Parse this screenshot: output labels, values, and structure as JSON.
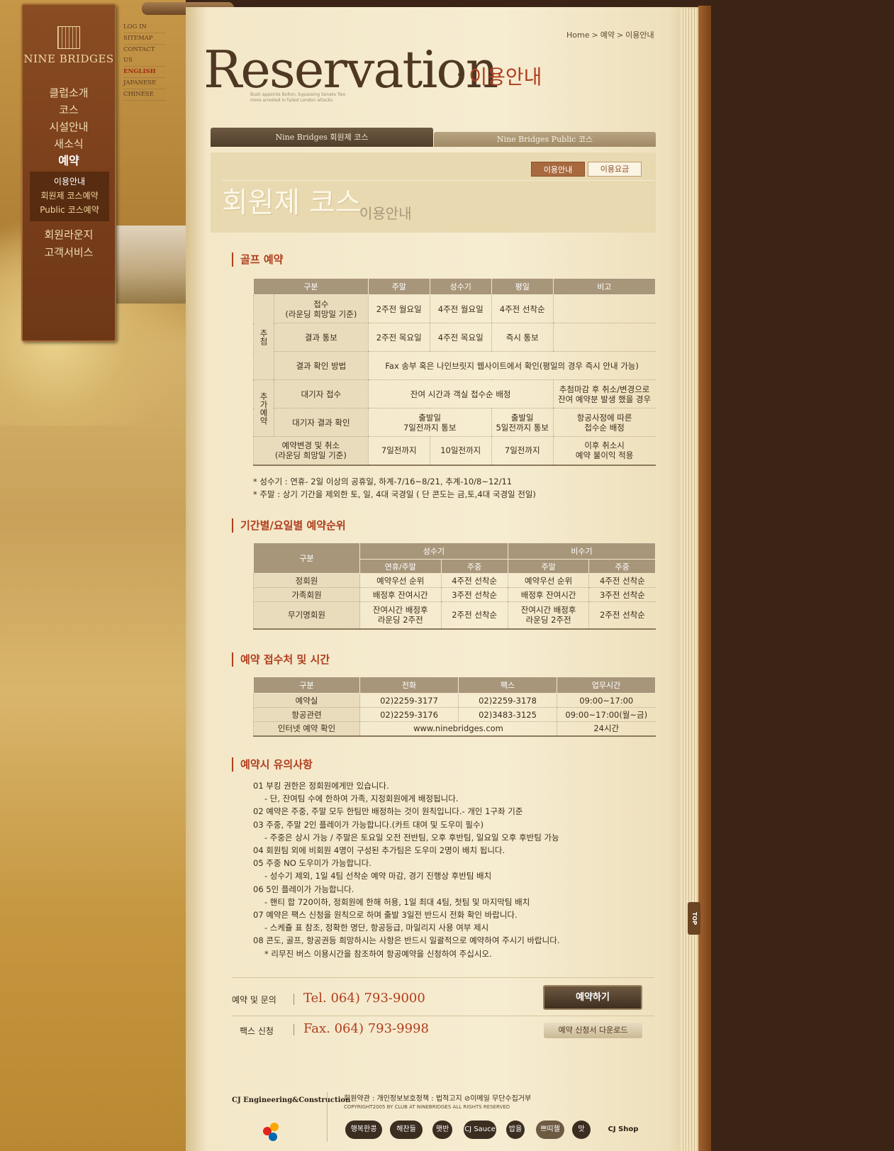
{
  "brand": {
    "logo_text": "NINE BRIDGES"
  },
  "util_nav": [
    "LOG IN",
    "SITEMAP",
    "CONTACT US",
    "ENGLISH",
    "JAPANESE",
    "CHINESE"
  ],
  "main_nav": [
    "클럽소개",
    "코스",
    "시설안내",
    "새소식",
    "예약"
  ],
  "sub_nav": [
    "이용안내",
    "회원제 코스예약",
    "Public 코스예약"
  ],
  "main_nav2": [
    "회원라운지",
    "고객서비스"
  ],
  "breadcrumb": [
    "Home",
    "예약",
    "이용안내"
  ],
  "hero": {
    "title_en": "Reservation",
    "title_ko": "이용안내",
    "subtext": "Bush appoints Bolton, bypassing Senate Two more arrested in failed London attacks"
  },
  "course_tabs": [
    "Nine Bridges 회원제 코스",
    "Nine Bridges Public 코스"
  ],
  "buttons": {
    "info": "이용안내",
    "fee": "이용요금"
  },
  "section_title": {
    "main": "회원제 코스",
    "sub": "이용안내"
  },
  "golf_reservation": {
    "title": "골프 예약",
    "headers": [
      "구분",
      "주말",
      "성수기",
      "평일",
      "비고"
    ],
    "lottery_label": "추첨",
    "additional_label": "추가예약",
    "rows": [
      {
        "label": "접수\n(라운딩 희망일 기준)",
        "weekend": "2주전 월요일",
        "peak": "4주전 월요일",
        "weekday": "4주전 선착순",
        "note": ""
      },
      {
        "label": "결과 통보",
        "weekend": "2주전 목요일",
        "peak": "4주전 목요일",
        "weekday": "즉시 통보",
        "note": ""
      },
      {
        "label": "결과 확인 방법",
        "merged": "Fax 송부 혹은 나인브릿지 웹사이트에서 확인(평일의 경우 즉시 안내 가능)"
      },
      {
        "label": "대기자 접수",
        "merged": "잔여 시간과 객실 접수순 배정",
        "note": "추첨마감 후 취소/변경으로\n잔여 예약분 발생 했을 경우"
      },
      {
        "label": "대기자 결과 확인",
        "a": "출발일\n7일전까지 통보",
        "b": "출발일\n5일전까지 통보",
        "note": "항공사정에 따른\n접수순 배정"
      },
      {
        "label": "예약변경 및 취소\n(라운딩 희망일 기준)",
        "weekend": "7일전까지",
        "peak": "10일전까지",
        "weekday": "7일전까지",
        "note": "이후 취소시\n예약 불이익 적용"
      }
    ],
    "notes": [
      "* 성수기 : 연휴- 2일 이상의 공휴일, 하계-7/16~8/21, 추계-10/8~12/11",
      "* 주말 : 상기 기간을 제외한 토, 일, 4대 국경일 ( 단 콘도는 금,토,4대 국경일 전일)"
    ]
  },
  "priority": {
    "title": "기간별/요일별 예약순위",
    "header_main": [
      "구분",
      "성수기",
      "비수기"
    ],
    "header_sub": [
      "연휴/주말",
      "주중",
      "주말",
      "주중"
    ],
    "rows": [
      [
        "정회원",
        "예약우선 순위",
        "4주전 선착순",
        "예약우선 순위",
        "4주전 선착순"
      ],
      [
        "가족회원",
        "배정후 잔여시간",
        "3주전 선착순",
        "배정후 잔여시간",
        "3주전 선착순"
      ],
      [
        "무기명회원",
        "잔여시간 배정후\n라운딩 2주전",
        "2주전 선착순",
        "잔여시간 배정후\n라운딩 2주전",
        "2주전 선착순"
      ]
    ]
  },
  "contact_table": {
    "title": "예약 접수처 및 시간",
    "headers": [
      "구분",
      "전화",
      "팩스",
      "업무시간"
    ],
    "rows": [
      [
        "예약실",
        "02)2259-3177",
        "02)2259-3178",
        "09:00~17:00"
      ],
      [
        "항공관련",
        "02)2259-3176",
        "02)3483-3125",
        "09:00~17:00(월~금)"
      ],
      [
        "인터넷 예약 확인",
        "www.ninebridges.com",
        "24시간"
      ]
    ]
  },
  "cautions": {
    "title": "예약시 유의사항",
    "lines": [
      {
        "t": "01 부킹 권한은 정회원에게만 있습니다.",
        "indent": false
      },
      {
        "t": "- 단, 잔여팀 수에 한하여 가족, 지정회원에게 배정됩니다.",
        "indent": true
      },
      {
        "t": "02 예약은 주중, 주말 모두 한팀만 배정하는 것이 원칙입니다.- 개인 1구좌 기준",
        "indent": false
      },
      {
        "t": "03 주중, 주말 2인 플레이가 가능합니다.(카트 대여 및 도우미 필수)",
        "indent": false
      },
      {
        "t": "- 주중은 상시 가능 / 주말은 토요일 오전 전반팀, 오후 후반팀, 일요일 오후 후반팀 가능",
        "indent": true
      },
      {
        "t": "04 회원팀 외에 비회원 4명이 구성된 추가팀은 도우미 2명이 배치 됩니다.",
        "indent": false
      },
      {
        "t": "05 주중 NO 도우미가 가능합니다.",
        "indent": false
      },
      {
        "t": "- 성수기 제외, 1일 4팀 선착순 예약 마감, 경기 진행상 후반팀 배치",
        "indent": true
      },
      {
        "t": "06 5인 플레이가 가능합니다.",
        "indent": false
      },
      {
        "t": "- 핸티 합 720이하, 정회원에 한해 허용, 1일 최대 4팀, 첫팀 및 마지막팀 배치",
        "indent": true
      },
      {
        "t": "07 예약은 팩스 신청을 원칙으로 하며 출발 3일전 반드시 전화 확인 바랍니다.",
        "indent": false
      },
      {
        "t": "- 스케쥴 표 참조, 정확한 명단, 항공등급, 마일리지 사용 여부 제시",
        "indent": true
      },
      {
        "t": "08 콘도, 골프, 항공권등 희망하시는 사항은 반드시 일괄적으로 예약하여 주시기 바랍니다.",
        "indent": false
      },
      {
        "t": "* 리무진 버스 이용시간을 참조하여 항공예약을 신청하여 주십시오.",
        "indent": true
      }
    ]
  },
  "contact": {
    "inquiry_label": "예약 및 문의",
    "tel": "Tel. 064) 793-9000",
    "fax_label": "팩스 신청",
    "fax": "Fax. 064) 793-9998",
    "reserve_button": "예약하기",
    "download_button": "예약 신청서 다운로드"
  },
  "footer": {
    "company": "CJ Engineering&Construction",
    "links": "회원약관 : 개인정보보호정책 : 법적고지  ⊘이메일 무단수집거부",
    "copyright": "COPYRIGHT2005 BY CLUB AT NINEBRIDGES ALL RIGHTS RESERVED",
    "family": [
      "행복한콩",
      "해찬들",
      "햇반",
      "CJ Sauce",
      "밥을",
      "쁘띠첼",
      "맛",
      "CJ Shop"
    ],
    "top_label": "TOP"
  },
  "colors": {
    "accent": "#b03d1d",
    "header_bg": "#a8967a",
    "menu_bg": "#7b3f1b"
  }
}
